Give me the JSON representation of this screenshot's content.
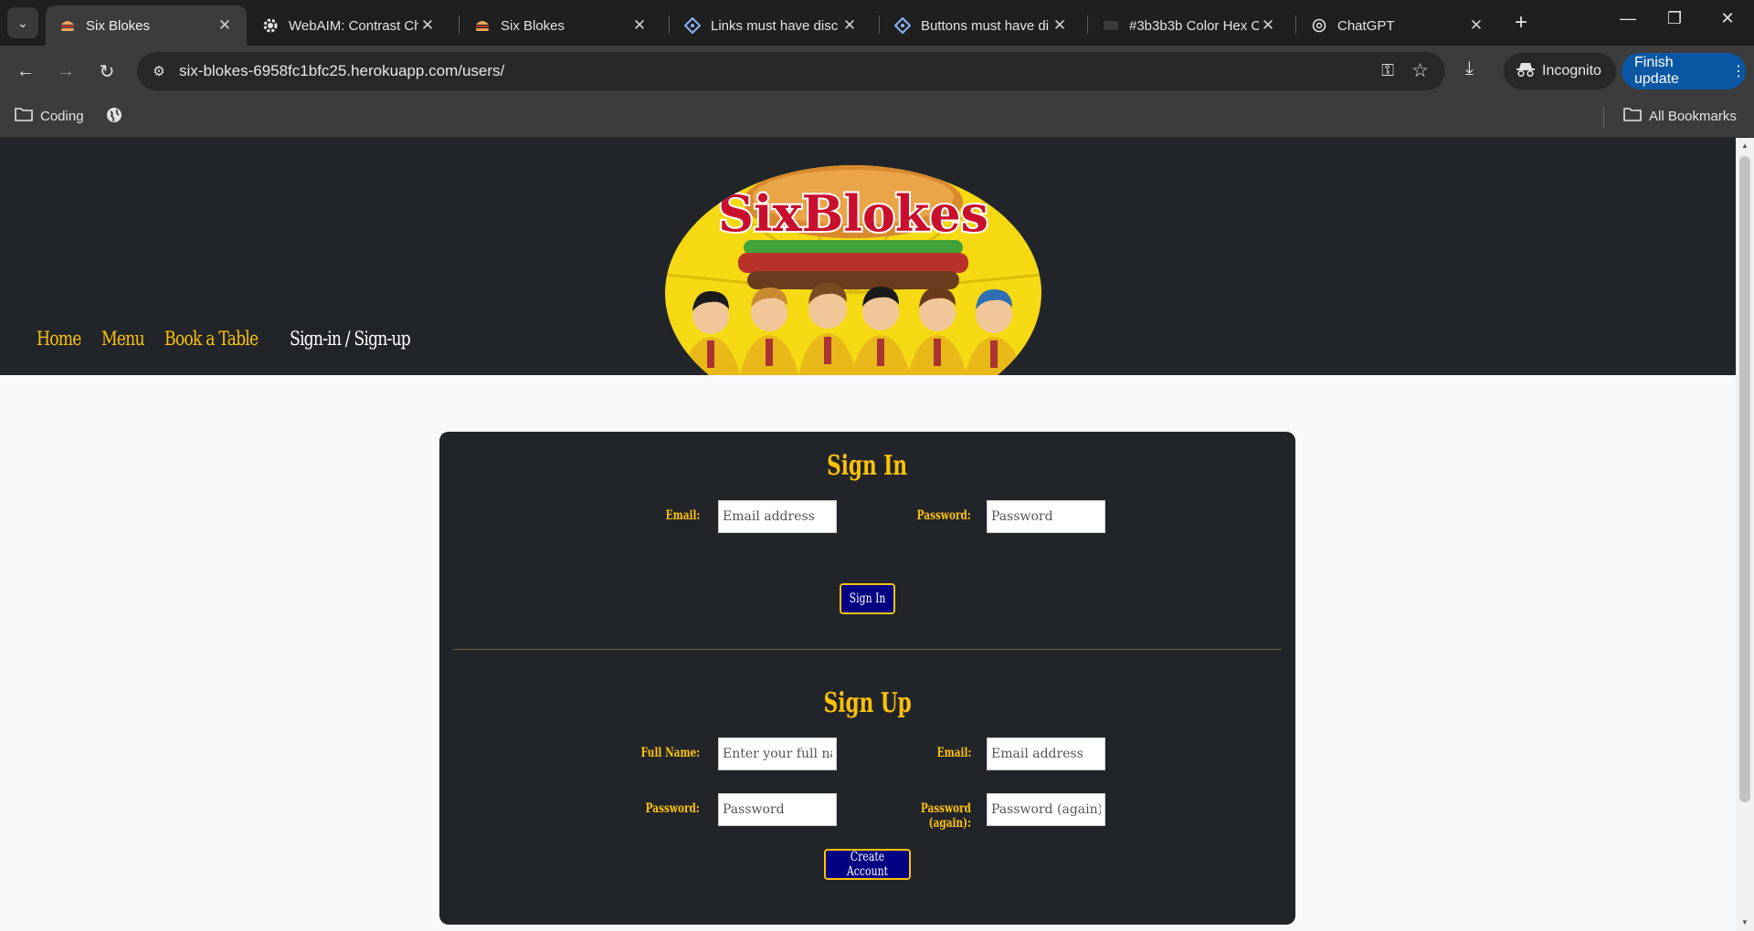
{
  "browser": {
    "tabs": [
      {
        "title": "Six Blokes",
        "icon": "burger-icon",
        "active": true
      },
      {
        "title": "WebAIM: Contrast Ch",
        "icon": "gear-icon",
        "active": false
      },
      {
        "title": "Six Blokes",
        "icon": "burger-icon",
        "active": false
      },
      {
        "title": "Links must have disc",
        "icon": "diamond-icon",
        "active": false
      },
      {
        "title": "Buttons must have di",
        "icon": "diamond-icon",
        "active": false
      },
      {
        "title": "#3b3b3b Color Hex C",
        "icon": "hex-icon",
        "active": false
      },
      {
        "title": "ChatGPT",
        "icon": "openai-icon",
        "active": false
      }
    ],
    "url": "six-blokes-6958fc1bfc25.herokuapp.com/users/",
    "incognito_label": "Incognito",
    "finish_update_label": "Finish update",
    "bookmarks": [
      {
        "label": "Coding",
        "icon": "folder-icon"
      },
      {
        "label": "",
        "icon": "globe-icon"
      }
    ],
    "all_bookmarks_label": "All Bookmarks"
  },
  "site": {
    "logo_text": "SixBlokes",
    "nav": [
      {
        "label": "Home",
        "current": false
      },
      {
        "label": "Menu",
        "current": false
      },
      {
        "label": "Book a Table",
        "current": false
      },
      {
        "label": "Sign-in / Sign-up",
        "current": true
      }
    ]
  },
  "signin": {
    "title": "Sign In",
    "email_label": "Email:",
    "email_placeholder": "Email address",
    "password_label": "Password:",
    "password_placeholder": "Password",
    "button": "Sign In"
  },
  "signup": {
    "title": "Sign Up",
    "fullname_label": "Full Name:",
    "fullname_placeholder": "Enter your full name",
    "email_label": "Email:",
    "email_placeholder": "Email address",
    "password_label": "Password:",
    "password_placeholder": "Password",
    "password2_label": "Password (again):",
    "password2_placeholder": "Password (again)",
    "button": "Create Account"
  },
  "colors": {
    "header_bg": "#212529",
    "accent_yellow": "#ffc107",
    "button_bg": "#000080",
    "page_bg": "#f8f9fb"
  }
}
